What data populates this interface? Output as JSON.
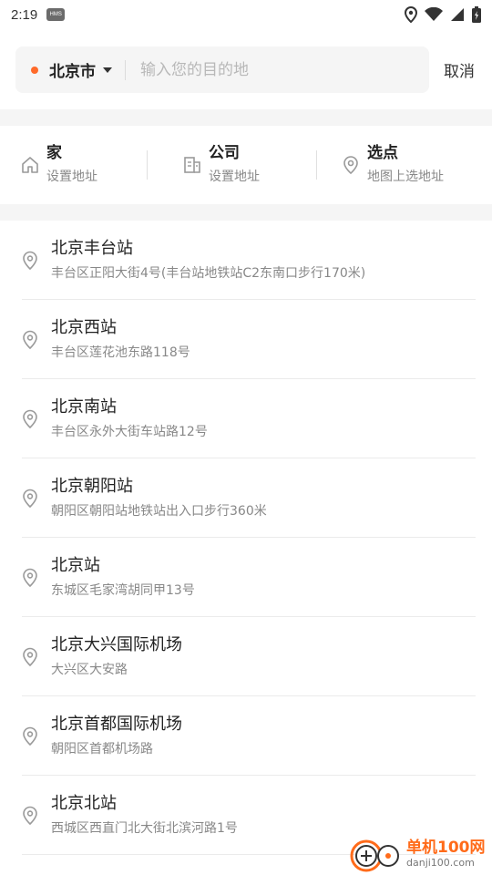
{
  "status_bar": {
    "time": "2:19",
    "notif_label": "HMS"
  },
  "search": {
    "city": "北京市",
    "placeholder": "输入您的目的地",
    "cancel_label": "取消",
    "accent_color": "#ff6a2a"
  },
  "shortcuts": [
    {
      "title": "家",
      "subtitle": "设置地址",
      "icon": "home-icon"
    },
    {
      "title": "公司",
      "subtitle": "设置地址",
      "icon": "building-icon"
    },
    {
      "title": "选点",
      "subtitle": "地图上选地址",
      "icon": "location-pin-icon"
    }
  ],
  "places": [
    {
      "name": "北京丰台站",
      "address": "丰台区正阳大街4号(丰台站地铁站C2东南口步行170米)"
    },
    {
      "name": "北京西站",
      "address": "丰台区莲花池东路118号"
    },
    {
      "name": "北京南站",
      "address": "丰台区永外大街车站路12号"
    },
    {
      "name": "北京朝阳站",
      "address": "朝阳区朝阳站地铁站出入口步行360米"
    },
    {
      "name": "北京站",
      "address": "东城区毛家湾胡同甲13号"
    },
    {
      "name": "北京大兴国际机场",
      "address": "大兴区大安路"
    },
    {
      "name": "北京首都国际机场",
      "address": "朝阳区首都机场路"
    },
    {
      "name": "北京北站",
      "address": "西城区西直门北大街北滨河路1号"
    }
  ],
  "watermark": {
    "name": "单机100网",
    "url": "danji100.com"
  }
}
